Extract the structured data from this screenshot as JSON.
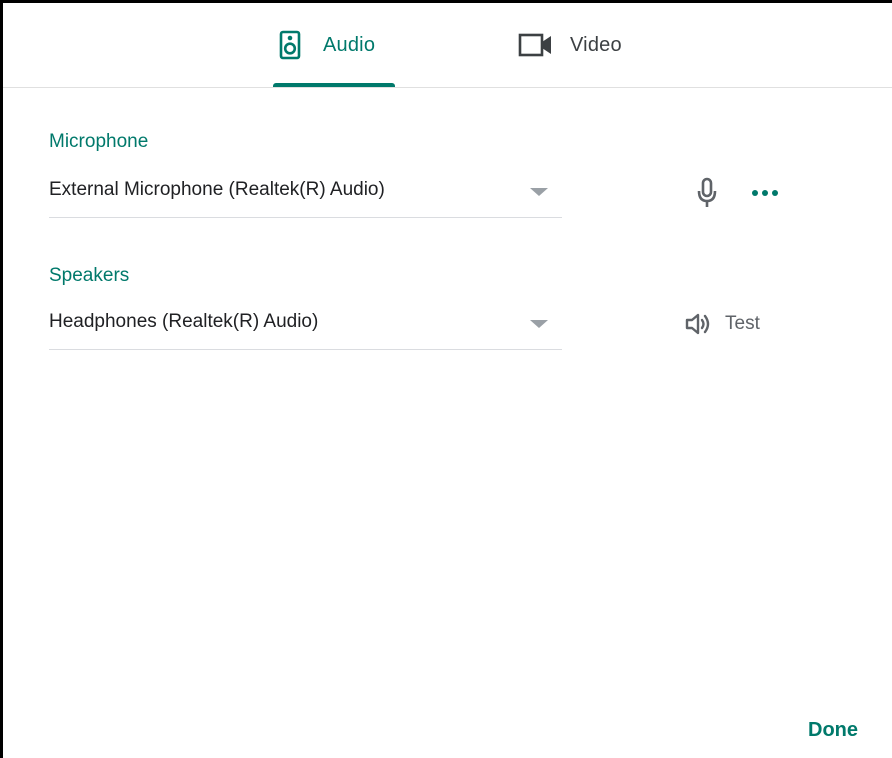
{
  "tabs": {
    "audio": {
      "label": "Audio",
      "icon": "speaker-icon",
      "selected": true
    },
    "video": {
      "label": "Video",
      "icon": "videocam-icon",
      "selected": false
    }
  },
  "microphone": {
    "label": "Microphone",
    "selected": "External Microphone (Realtek(R) Audio)",
    "icons": [
      "mic-icon",
      "more-options-icon"
    ]
  },
  "speakers": {
    "label": "Speakers",
    "selected": "Headphones (Realtek(R) Audio)",
    "test_label": "Test",
    "icon": "volume-icon"
  },
  "footer": {
    "done_label": "Done"
  },
  "colors": {
    "accent": "#00796b",
    "text": "#202124",
    "secondary_text": "#5f6368",
    "divider": "#e0e0e0"
  }
}
